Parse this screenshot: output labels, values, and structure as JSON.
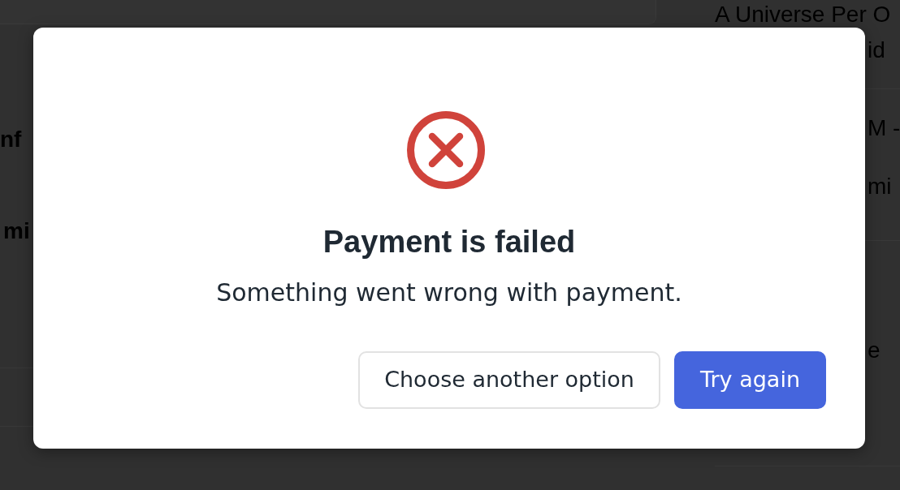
{
  "background": {
    "main": {
      "fragments": [
        {
          "text": "nf",
          "kind": "heading"
        },
        {
          "text": "mi",
          "kind": "heading"
        }
      ]
    },
    "sidebar": {
      "sections": [
        {
          "lines": [
            {
              "text": "A Universe Per O",
              "kind": "line"
            },
            {
              "text": "id",
              "kind": "clipped"
            }
          ]
        },
        {
          "lines": [
            {
              "text": "M -",
              "kind": "clipped"
            },
            {
              "text": "mi",
              "kind": "clipped"
            }
          ]
        },
        {
          "lines": [
            {
              "text": "e",
              "kind": "clipped"
            }
          ]
        }
      ]
    }
  },
  "dialog": {
    "title": "Payment is failed",
    "message": "Something went wrong with payment.",
    "buttons": [
      {
        "label": "Choose another option",
        "kind": "secondary"
      },
      {
        "label": "Try again",
        "kind": "primary"
      }
    ]
  }
}
